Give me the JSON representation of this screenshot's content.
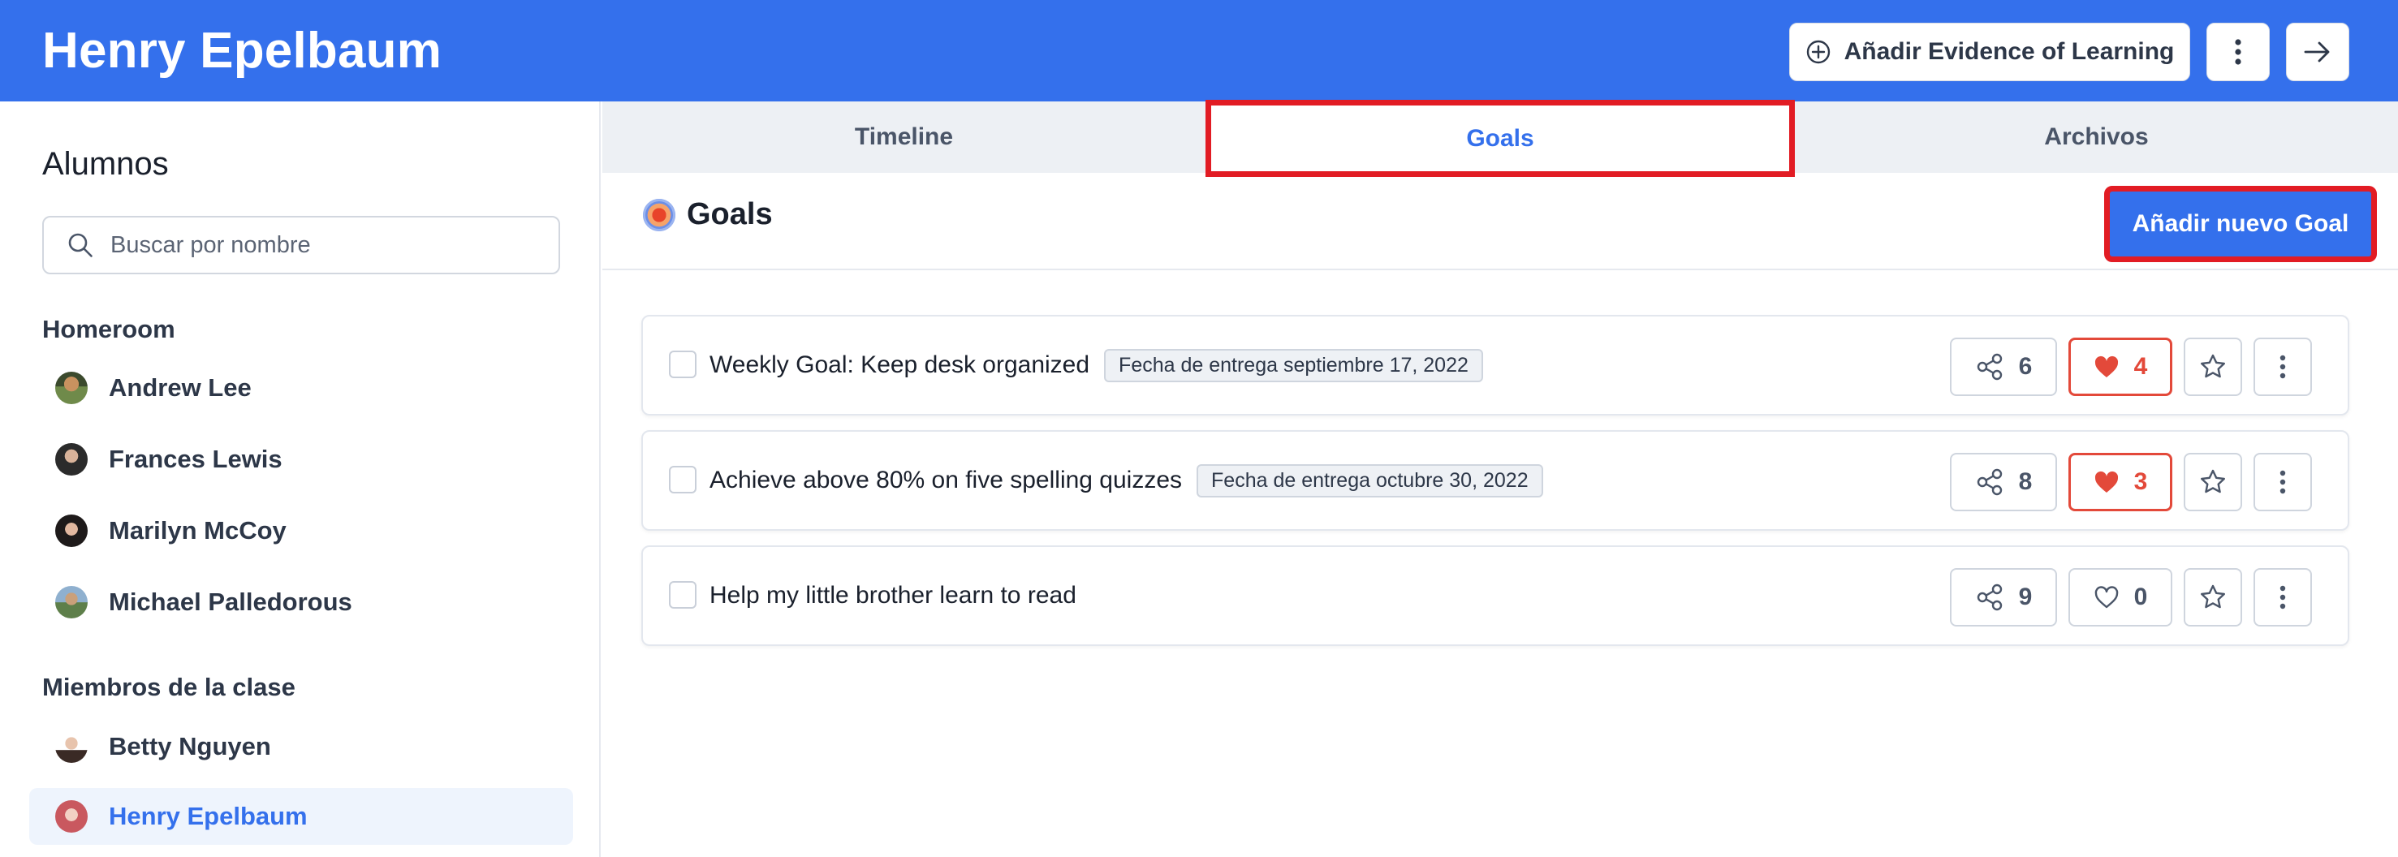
{
  "header": {
    "title": "Henry Epelbaum",
    "add_evidence_label": "Añadir Evidence of Learning"
  },
  "sidebar": {
    "title": "Alumnos",
    "search_placeholder": "Buscar por nombre",
    "homeroom_label": "Homeroom",
    "homeroom": [
      {
        "name": "Andrew Lee"
      },
      {
        "name": "Frances Lewis"
      },
      {
        "name": "Marilyn McCoy"
      },
      {
        "name": "Michael Palledorous"
      }
    ],
    "members_label": "Miembros de la clase",
    "members": [
      {
        "name": "Betty Nguyen"
      },
      {
        "name": "Henry Epelbaum",
        "active": true
      }
    ]
  },
  "tabs": [
    {
      "label": "Timeline"
    },
    {
      "label": "Goals",
      "active": true
    },
    {
      "label": "Archivos"
    }
  ],
  "goals": {
    "title": "Goals",
    "add_label": "Añadir nuevo Goal",
    "items": [
      {
        "title": "Weekly Goal: Keep desk organized",
        "due": "Fecha de entrega septiembre 17, 2022",
        "shares": "6",
        "likes": "4",
        "liked": true
      },
      {
        "title": "Achieve above 80% on five spelling quizzes",
        "due": "Fecha de entrega octubre 30, 2022",
        "shares": "8",
        "likes": "3",
        "liked": true
      },
      {
        "title": "Help my little brother learn to read",
        "due": "",
        "shares": "9",
        "likes": "0",
        "liked": false
      }
    ]
  },
  "colors": {
    "brand_blue": "#3470ec",
    "highlight_red": "#e21c24",
    "like_red": "#e3493a"
  }
}
